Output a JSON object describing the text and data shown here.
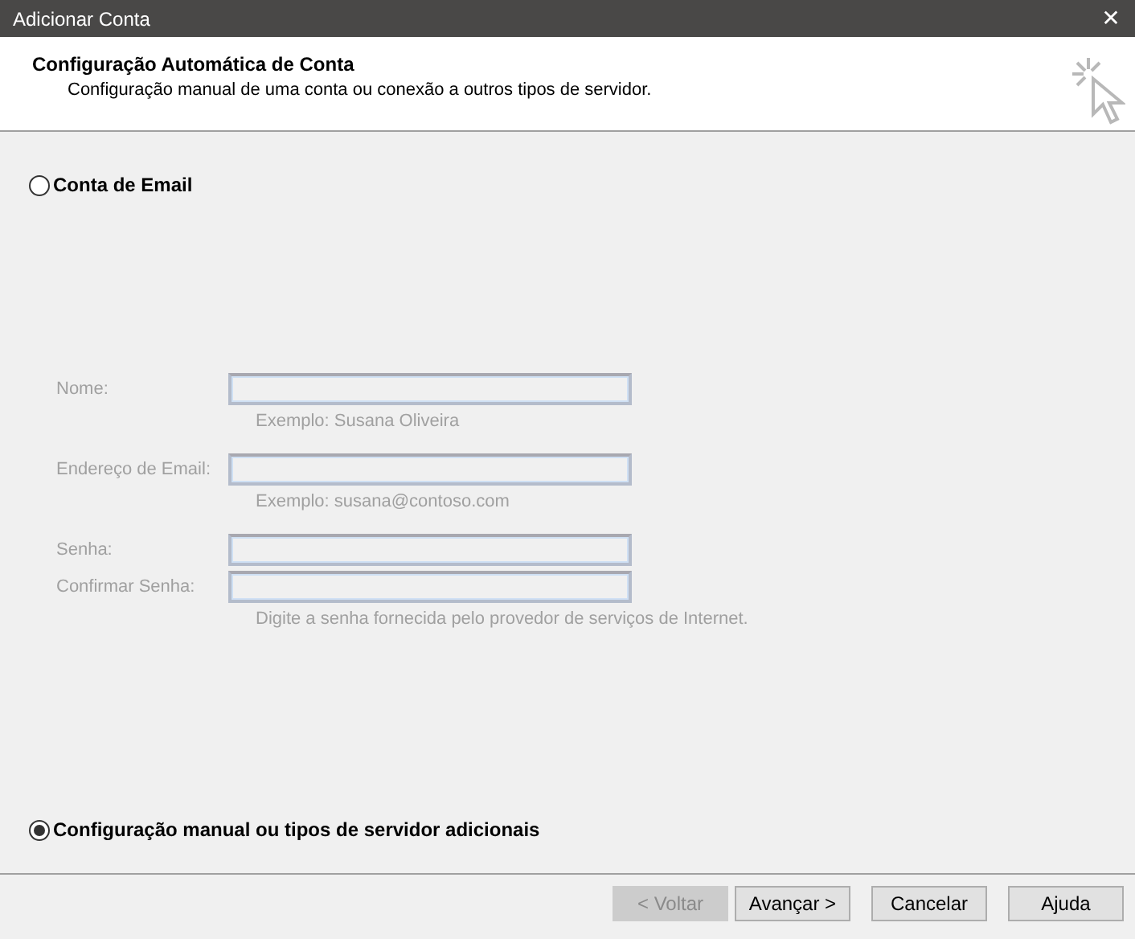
{
  "window": {
    "title": "Adicionar Conta",
    "close": "✕"
  },
  "header": {
    "title": "Configuração Automática de Conta",
    "subtitle": "Configuração manual de uma conta ou conexão a outros tipos de servidor."
  },
  "options": [
    {
      "label": "Conta de Email",
      "selected": false
    },
    {
      "label": "Configuração manual ou tipos de servidor adicionais",
      "selected": true
    }
  ],
  "fields": [
    {
      "label": "Nome:",
      "hint": "Exemplo: Susana Oliveira",
      "disabled": true
    },
    {
      "label": "Endereço de Email:",
      "hint": "Exemplo: susana@contoso.com",
      "disabled": true
    },
    {
      "label": "Senha:",
      "disabled": true
    },
    {
      "label": "Confirmar Senha:",
      "hint": "Digite a senha fornecida pelo provedor de serviços de Internet.",
      "disabled": true
    }
  ],
  "buttons": [
    {
      "label": "< Voltar",
      "disabled": true
    },
    {
      "label": "Avançar >",
      "disabled": false
    },
    {
      "label": "Cancelar",
      "disabled": false
    },
    {
      "label": "Ajuda",
      "disabled": false
    }
  ]
}
